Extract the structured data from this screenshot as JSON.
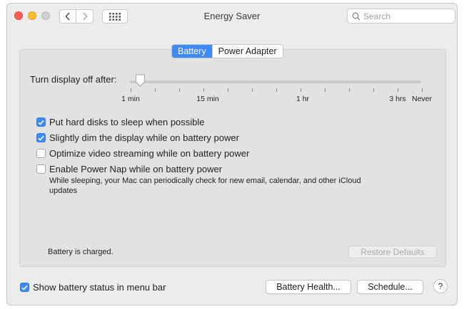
{
  "window": {
    "title": "Energy Saver"
  },
  "search": {
    "placeholder": "Search"
  },
  "tabs": [
    {
      "label": "Battery",
      "active": true
    },
    {
      "label": "Power Adapter",
      "active": false
    }
  ],
  "slider": {
    "label": "Turn display off after:",
    "value_label": "1 min",
    "ticks": [
      "1 min",
      "15 min",
      "1 hr",
      "3 hrs",
      "Never"
    ]
  },
  "options": [
    {
      "label": "Put hard disks to sleep when possible",
      "checked": true
    },
    {
      "label": "Slightly dim the display while on battery power",
      "checked": true
    },
    {
      "label": "Optimize video streaming while on battery power",
      "checked": false
    },
    {
      "label": "Enable Power Nap while on battery power",
      "checked": false
    }
  ],
  "power_nap_description": "While sleeping, your Mac can periodically check for new email, calendar, and other iCloud updates",
  "status_text": "Battery is charged.",
  "restore_defaults_label": "Restore Defaults",
  "menu_bar_option": {
    "label": "Show battery status in menu bar",
    "checked": true
  },
  "buttons": {
    "battery_health": "Battery Health...",
    "schedule": "Schedule...",
    "help": "?"
  },
  "colors": {
    "accent": "#3d8af7",
    "window_bg": "#ececec",
    "panel_bg": "#e2e2e2"
  }
}
